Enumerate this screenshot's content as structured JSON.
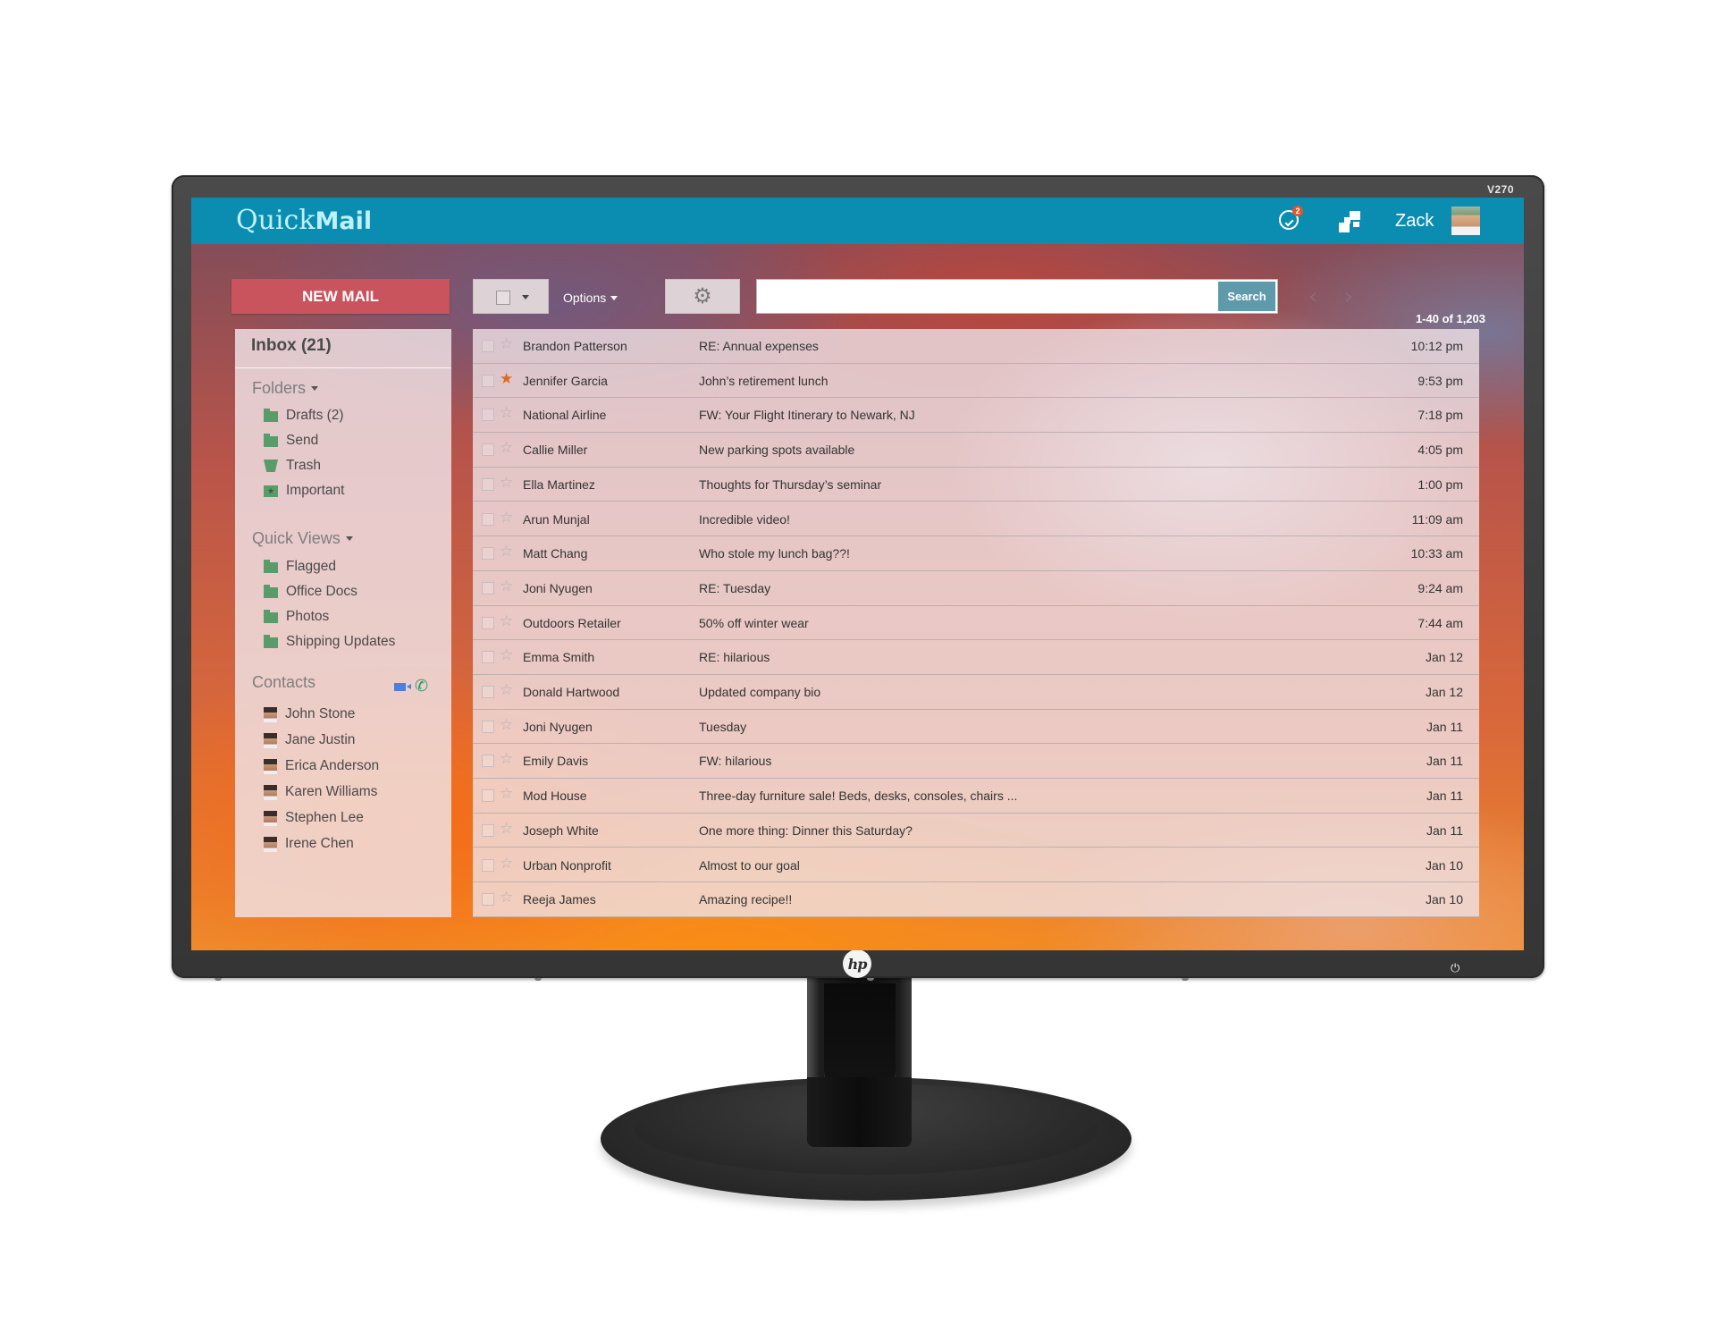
{
  "monitor": {
    "model": "V270",
    "logo": "hp",
    "power_icon": "power-icon"
  },
  "app": {
    "brand_light": "Quick",
    "brand_bold": "Mail",
    "notifications_count": "2",
    "user_name": "Zack",
    "colors": {
      "topbar": "#0b8db1",
      "new_mail": "#c9545d",
      "search_button": "#5e9aaa",
      "folder_icon": "#5a9b6a",
      "starred": "#e06a1c"
    }
  },
  "toolbar": {
    "new_mail_label": "NEW MAIL",
    "options_label": "Options",
    "search_placeholder": "",
    "search_value": "",
    "search_label": "Search",
    "prev_glyph": "‹",
    "next_glyph": "›",
    "page_count": "1-40 of 1,203"
  },
  "sidebar": {
    "inbox_label": "Inbox (21)",
    "folders_label": "Folders",
    "folders": [
      {
        "label": "Drafts (2)",
        "icon": "folder-icon"
      },
      {
        "label": "Send",
        "icon": "folder-icon"
      },
      {
        "label": "Trash",
        "icon": "trash-icon"
      },
      {
        "label": "Important",
        "icon": "important-folder-icon"
      }
    ],
    "quick_views_label": "Quick Views",
    "quick_views": [
      {
        "label": "Flagged"
      },
      {
        "label": "Office Docs"
      },
      {
        "label": "Photos"
      },
      {
        "label": "Shipping Updates"
      }
    ],
    "contacts_label": "Contacts",
    "contacts": [
      {
        "name": "John Stone"
      },
      {
        "name": "Jane Justin"
      },
      {
        "name": "Erica Anderson"
      },
      {
        "name": "Karen Williams"
      },
      {
        "name": "Stephen Lee"
      },
      {
        "name": "Irene Chen"
      }
    ]
  },
  "emails": [
    {
      "from": "Brandon Patterson",
      "subject": "RE: Annual expenses",
      "time": "10:12 pm",
      "starred": false
    },
    {
      "from": "Jennifer Garcia",
      "subject": "John’s retirement lunch",
      "time": "9:53 pm",
      "starred": true
    },
    {
      "from": "National Airline",
      "subject": "FW: Your Flight Itinerary to Newark, NJ",
      "time": "7:18 pm",
      "starred": false
    },
    {
      "from": "Callie Miller",
      "subject": "New parking spots available",
      "time": "4:05 pm",
      "starred": false
    },
    {
      "from": "Ella Martinez",
      "subject": "Thoughts for Thursday’s seminar",
      "time": "1:00 pm",
      "starred": false
    },
    {
      "from": "Arun Munjal",
      "subject": "Incredible video!",
      "time": "11:09 am",
      "starred": false
    },
    {
      "from": "Matt Chang",
      "subject": "Who stole my lunch bag??!",
      "time": "10:33 am",
      "starred": false
    },
    {
      "from": "Joni Nyugen",
      "subject": "RE: Tuesday",
      "time": "9:24 am",
      "starred": false
    },
    {
      "from": "Outdoors Retailer",
      "subject": "50% off winter wear",
      "time": "7:44 am",
      "starred": false
    },
    {
      "from": "Emma Smith",
      "subject": "RE: hilarious",
      "time": "Jan 12",
      "starred": false
    },
    {
      "from": "Donald Hartwood",
      "subject": "Updated company bio",
      "time": "Jan 12",
      "starred": false
    },
    {
      "from": "Joni Nyugen",
      "subject": "Tuesday",
      "time": "Jan 11",
      "starred": false
    },
    {
      "from": "Emily Davis",
      "subject": "FW: hilarious",
      "time": "Jan 11",
      "starred": false
    },
    {
      "from": "Mod House",
      "subject": "Three-day furniture sale! Beds, desks, consoles, chairs ...",
      "time": "Jan 11",
      "starred": false
    },
    {
      "from": "Joseph White",
      "subject": "One more thing: Dinner this Saturday?",
      "time": "Jan 11",
      "starred": false
    },
    {
      "from": "Urban Nonprofit",
      "subject": "Almost to our goal",
      "time": "Jan 10",
      "starred": false
    },
    {
      "from": "Reeja James",
      "subject": "Amazing recipe!!",
      "time": "Jan 10",
      "starred": false
    }
  ]
}
